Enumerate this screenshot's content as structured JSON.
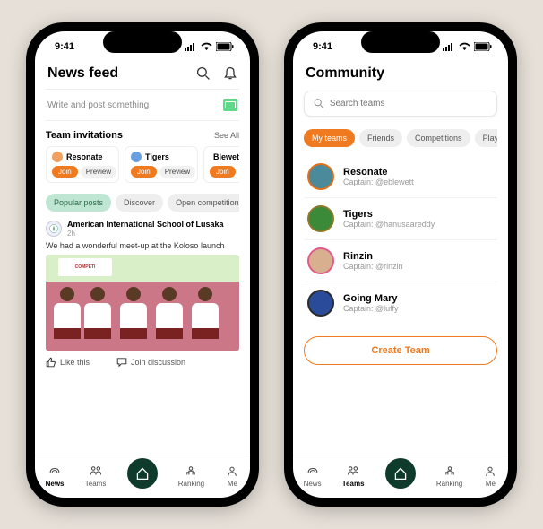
{
  "statusbar": {
    "time": "9:41"
  },
  "phone1": {
    "header": {
      "title": "News feed"
    },
    "compose": {
      "placeholder": "Write and post something"
    },
    "invitations": {
      "title": "Team invitations",
      "see_all": "See All",
      "cards": [
        {
          "name": "Resonate",
          "join": "Join",
          "preview": "Preview",
          "color": "#f0a060"
        },
        {
          "name": "Tigers",
          "join": "Join",
          "preview": "Preview",
          "color": "#6aa0e0"
        },
        {
          "name": "Blewett",
          "join": "Join",
          "preview": "",
          "color": "#c080d0"
        }
      ]
    },
    "feed_tabs": [
      {
        "label": "Popular posts",
        "active": true
      },
      {
        "label": "Discover",
        "active": false
      },
      {
        "label": "Open competitions",
        "active": false
      }
    ],
    "post": {
      "author": "American International School of Lusaka",
      "time": "2h",
      "body": "We had a wonderful meet-up at the Koloso launch",
      "like": "Like this",
      "discuss": "Join discussion",
      "banner": "COMPETI"
    },
    "nav": [
      "News",
      "Teams",
      "",
      "Ranking",
      "Me"
    ],
    "nav_active": 0
  },
  "phone2": {
    "header": {
      "title": "Community"
    },
    "search": {
      "placeholder": "Search teams"
    },
    "tabs": [
      {
        "label": "My teams",
        "active": true
      },
      {
        "label": "Friends",
        "active": false
      },
      {
        "label": "Competitions",
        "active": false
      },
      {
        "label": "Player",
        "active": false
      }
    ],
    "captain_prefix": "Captain: ",
    "teams": [
      {
        "name": "Resonate",
        "captain": "@eblewett",
        "bg": "#4a8a9a",
        "ring": "#e0701a"
      },
      {
        "name": "Tigers",
        "captain": "@hanusaareddy",
        "bg": "#3a8a3a",
        "ring": "#8a7a2a"
      },
      {
        "name": "Rinzin",
        "captain": "@rinzin",
        "bg": "#d8b090",
        "ring": "#e05a8a"
      },
      {
        "name": "Going Mary",
        "captain": "@luffy",
        "bg": "#2a4a9a",
        "ring": "#2a2a2a"
      }
    ],
    "create": "Create Team",
    "nav": [
      "News",
      "Teams",
      "",
      "Ranking",
      "Me"
    ],
    "nav_active": 1
  }
}
